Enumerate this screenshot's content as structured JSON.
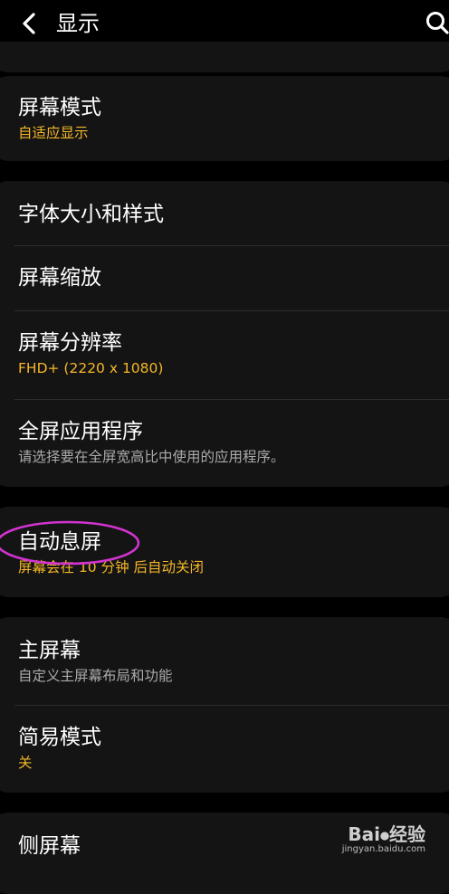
{
  "header": {
    "back_icon": "chevron-left-icon",
    "title": "显示",
    "search_icon": "search-icon"
  },
  "cards": [
    {
      "items": [
        {
          "title": "屏幕模式",
          "subtitle": "自适应显示",
          "subtitle_accent": true
        }
      ]
    },
    {
      "items": [
        {
          "title": "字体大小和样式"
        },
        {
          "title": "屏幕缩放"
        },
        {
          "title": "屏幕分辨率",
          "subtitle": "FHD+ (2220 x 1080)",
          "subtitle_accent": true
        },
        {
          "title": "全屏应用程序",
          "subtitle": "请选择要在全屏宽高比中使用的应用程序。",
          "subtitle_accent": false
        }
      ]
    },
    {
      "items": [
        {
          "title": "自动息屏",
          "subtitle": "屏幕会在 10 分钟 后自动关闭",
          "subtitle_accent": true,
          "circled": true
        }
      ]
    },
    {
      "items": [
        {
          "title": "主屏幕",
          "subtitle": "自定义主屏幕布局和功能",
          "subtitle_accent": false
        },
        {
          "title": "简易模式",
          "subtitle": "关",
          "subtitle_accent": true
        }
      ]
    },
    {
      "items": [
        {
          "title": "侧屏幕"
        }
      ]
    }
  ],
  "watermark": {
    "brand": "Bai⦁经验",
    "url": "jingyan.baidu.com"
  },
  "colors": {
    "background": "#000000",
    "card": "#141414",
    "accent": "#f5b728",
    "secondary_text": "#aaaaaa",
    "highlight_circle": "#d233d0"
  }
}
